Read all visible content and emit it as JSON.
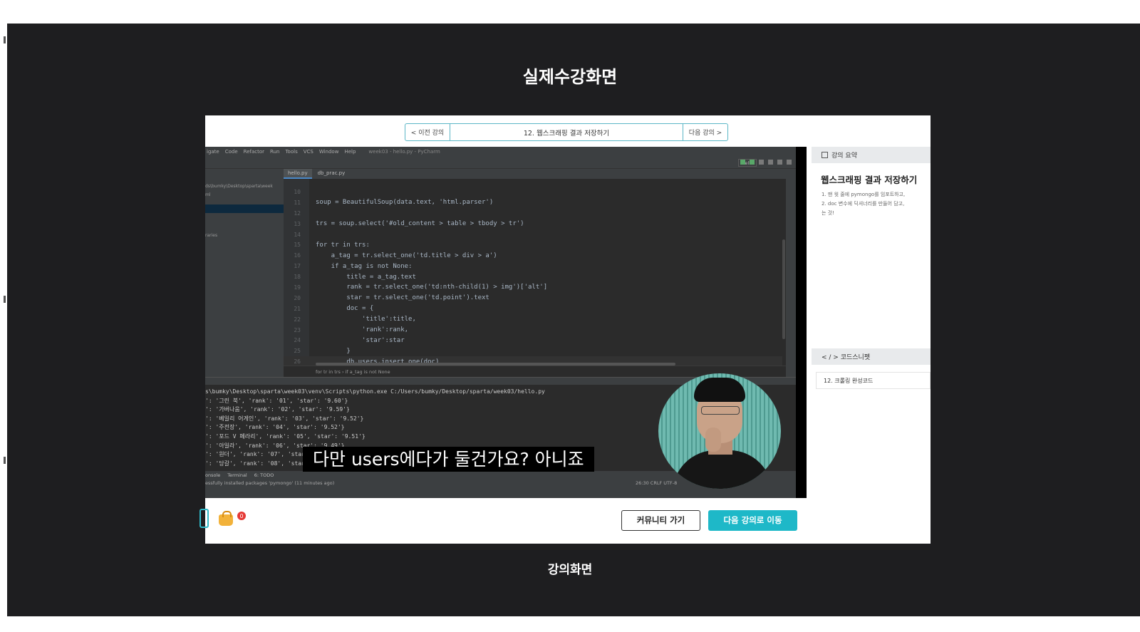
{
  "page": {
    "heading_top": "실제수강화면",
    "heading_bottom": "강의화면"
  },
  "lecture_nav": {
    "prev_label": "< 이전 강의",
    "title": "12. 웹스크래핑 결과 저장하기",
    "next_label": "다음 강의 >"
  },
  "ide": {
    "menu": [
      "igate",
      "Code",
      "Refactor",
      "Run",
      "Tools",
      "VCS",
      "Window",
      "Help",
      "week03 - hello.py - PyCharm"
    ],
    "run_config": "hello",
    "tabs": [
      "hello.py",
      "db_prac.py"
    ],
    "project_labels": [
      "ds\\bumky\\Desktop\\sparta\\week",
      "ml",
      "raries"
    ],
    "code_lines": [
      {
        "n": "10",
        "t": ""
      },
      {
        "n": "11",
        "t": "soup = BeautifulSoup(data.text, 'html.parser')"
      },
      {
        "n": "12",
        "t": ""
      },
      {
        "n": "13",
        "t": "trs = soup.select('#old_content > table > tbody > tr')"
      },
      {
        "n": "14",
        "t": ""
      },
      {
        "n": "15",
        "t": "for tr in trs:"
      },
      {
        "n": "16",
        "t": "    a_tag = tr.select_one('td.title > div > a')"
      },
      {
        "n": "17",
        "t": "    if a_tag is not None:"
      },
      {
        "n": "18",
        "t": "        title = a_tag.text"
      },
      {
        "n": "19",
        "t": "        rank = tr.select_one('td:nth-child(1) > img')['alt']"
      },
      {
        "n": "20",
        "t": "        star = tr.select_one('td.point').text"
      },
      {
        "n": "21",
        "t": "        doc = {"
      },
      {
        "n": "22",
        "t": "            'title':title,"
      },
      {
        "n": "23",
        "t": "            'rank':rank,"
      },
      {
        "n": "24",
        "t": "            'star':star"
      },
      {
        "n": "25",
        "t": "        }"
      },
      {
        "n": "26",
        "t": "        db.users.insert_one(doc)"
      }
    ],
    "breadcrumb": "for tr in trs  ›  if a_tag is not None",
    "run_lines": [
      "s\\bumky\\Desktop\\sparta\\week03\\venv\\Scripts\\python.exe C:/Users/bumky/Desktop/sparta/week03/hello.py",
      "': '그린 북', 'rank': '01', 'star': '9.60'}",
      "': '가버나움', 'rank': '02', 'star': '9.59'}",
      "': '베일리 어게인', 'rank': '03', 'star': '9.52'}",
      "': '주전장', 'rank': '04', 'star': '9.52'}",
      "': '포드 V 페라리', 'rank': '05', 'star': '9.51'}",
      "': '아일라', 'rank': '06', 'star': '9.49'}",
      "': '원더', 'rank': '07', 'star': '9.49'}",
      "': '당갈', 'rank': '08', 'star': '9.48'}"
    ],
    "status_tabs": [
      "onsole",
      "Terminal",
      "6: TODO"
    ],
    "status_message": "essfully installed packages 'pymongo' (11 minutes ago)",
    "status_right": "26:30   CRLF   UTF-8"
  },
  "video": {
    "subtitle": "다만 users에다가 둘건가요? 아니죠"
  },
  "summary_panel": {
    "header": "강의 요약",
    "title": "웹스크래핑 결과 저장하기",
    "items": [
      "1. 맨 윗 줄에 pymongo를 임포트하고,",
      "2. doc 변수에 딕셔너리를 만들어 담고,",
      "    는 것!"
    ]
  },
  "snippet_panel": {
    "header": "< / > 코드스니펫",
    "item": "12. 크롤링 완성코드"
  },
  "bottom_bar": {
    "badge_count": "0",
    "community_label": "커뮤니티 가기",
    "next_lecture_label": "다음 강의로 이동"
  }
}
